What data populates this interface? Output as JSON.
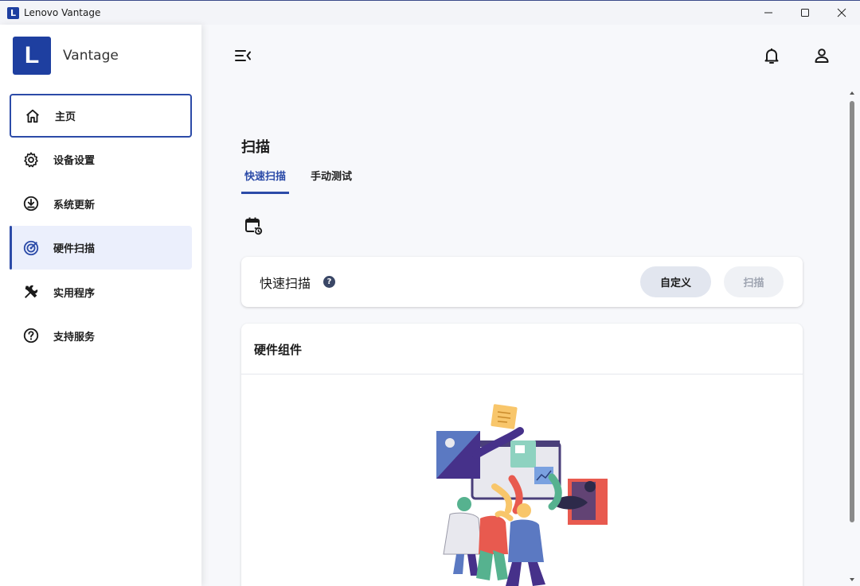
{
  "window": {
    "title": "Lenovo Vantage",
    "badge": "L"
  },
  "brand": {
    "logo_letter": "L",
    "name": "Vantage"
  },
  "sidebar": {
    "items": [
      {
        "label": "主页",
        "icon": "home-icon"
      },
      {
        "label": "设备设置",
        "icon": "gear-icon"
      },
      {
        "label": "系统更新",
        "icon": "download-icon"
      },
      {
        "label": "硬件扫描",
        "icon": "radar-icon"
      },
      {
        "label": "实用程序",
        "icon": "tools-icon"
      },
      {
        "label": "支持服务",
        "icon": "help-icon"
      }
    ]
  },
  "main": {
    "title": "扫描",
    "tabs": [
      {
        "label": "快速扫描"
      },
      {
        "label": "手动测试"
      }
    ],
    "scan_card": {
      "title": "快速扫描",
      "help": "?",
      "customize_label": "自定义",
      "scan_label": "扫描"
    },
    "hardware_card": {
      "title": "硬件组件"
    }
  },
  "colors": {
    "accent": "#2c4ba8",
    "brand": "#1e3fa0",
    "active_bg": "#ebeffc"
  }
}
